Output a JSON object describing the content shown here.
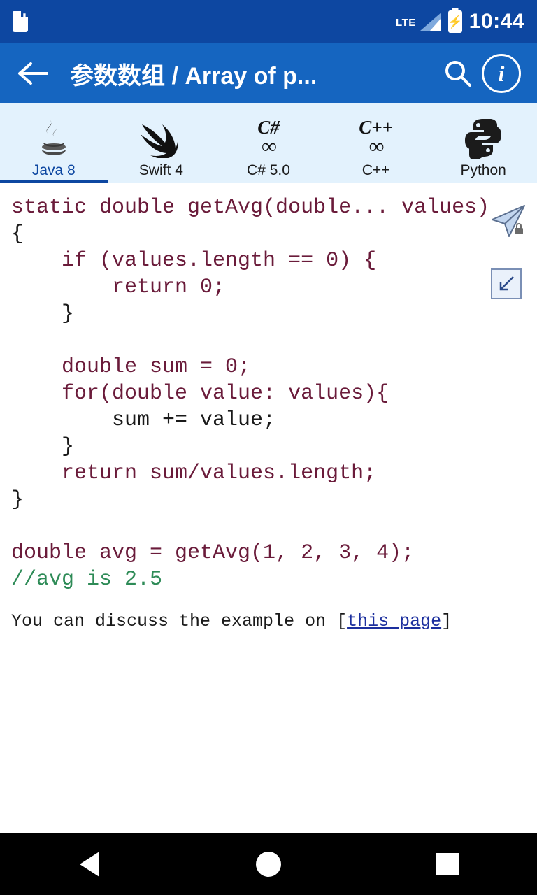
{
  "status_bar": {
    "sd_card_icon": "sd-card-icon",
    "network_label": "LTE",
    "signal_icon": "signal-bars-icon",
    "battery_icon": "battery-charging-icon",
    "time": "10:44"
  },
  "app_bar": {
    "back_icon": "back-arrow-icon",
    "title": "参数数组 / Array of p...",
    "search_icon": "search-icon",
    "info_icon": "info-icon"
  },
  "tabs": [
    {
      "label": "Java 8",
      "icon": "java-icon",
      "active": true
    },
    {
      "label": "Swift 4",
      "icon": "swift-bird-icon",
      "active": false
    },
    {
      "label": "C# 5.0",
      "icon": "csharp-icon",
      "active": false
    },
    {
      "label": "C++",
      "icon": "cplusplus-icon",
      "active": false
    },
    {
      "label": "Python",
      "icon": "python-icon",
      "active": false
    }
  ],
  "overlay": {
    "send_icon": "send-paper-plane-icon",
    "collapse_icon": "collapse-arrow-icon"
  },
  "code": {
    "lines": [
      "static double getAvg(double... values)",
      "{",
      "    if (values.length == 0) {",
      "        return 0;",
      "    }",
      "",
      "    double sum = 0;",
      "    for(double value: values){",
      "        sum += value;",
      "    }",
      "    return sum/values.length;",
      "}",
      "",
      "double avg = getAvg(1, 2, 3, 4);",
      "//avg is 2.5"
    ]
  },
  "discuss": {
    "prefix": "You can discuss the example on [",
    "link": "this page",
    "suffix": "]"
  },
  "nav_bar": {
    "back": "nav-back-icon",
    "home": "nav-home-icon",
    "recent": "nav-recent-icon"
  },
  "colors": {
    "status_bar": "#0d47a1",
    "app_bar": "#1565c0",
    "tab_bar": "#e3f2fd",
    "accent": "#0d47a1",
    "keyword": "#6a1b3a",
    "property": "#1c2f9e",
    "comment": "#2e8b57"
  }
}
